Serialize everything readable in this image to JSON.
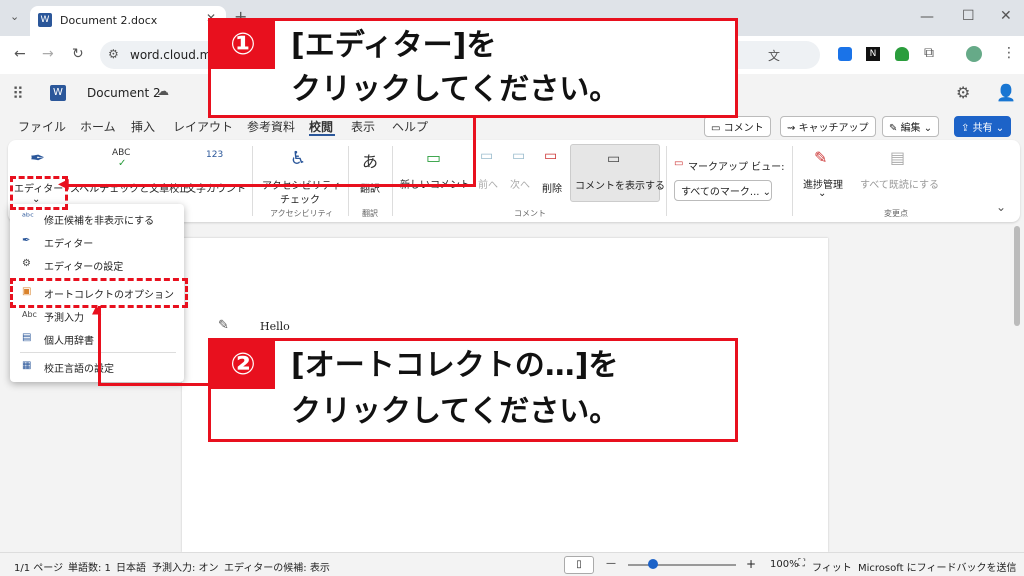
{
  "browser": {
    "tab_title": "Document 2.docx",
    "new_tab": "+",
    "url": "word.cloud.mic"
  },
  "app": {
    "doc_title": "Document 2",
    "logo": "W"
  },
  "menu": {
    "items": [
      "ファイル",
      "ホーム",
      "挿入",
      "レイアウト",
      "参考資料",
      "校閲",
      "表示",
      "ヘルプ"
    ],
    "comment_btn": "コメント",
    "catchup_btn": "キャッチアップ",
    "edit_btn": "編集",
    "share_btn": "共有"
  },
  "ribbon": {
    "editor": "エディター",
    "spellcheck": "スペルチェックと文章校正",
    "wordcount": "文字カウント",
    "accessibility_line1": "アクセシビリティ",
    "accessibility_line2": "チェック",
    "translate": "翻訳",
    "new_comment": "新しいコメント",
    "prev": "前へ",
    "next": "次へ",
    "delete": "削除",
    "show_comments": "コメントを表示する",
    "markup_view": "マークアップ ビュー:",
    "all_markup": "すべてのマーク...",
    "track_changes": "進捗管理",
    "accept_all": "すべて既読にする",
    "group_accessibility": "アクセシビリティ",
    "group_translate": "翻訳",
    "group_comments": "コメント",
    "group_changes": "変更点",
    "abc": "ABC",
    "num123": "123"
  },
  "dropdown": {
    "items": [
      "修正候補を非表示にする",
      "エディター",
      "エディターの設定",
      "オートコレクトのオプション",
      "予測入力",
      "個人用辞書",
      "校正言語の設定"
    ],
    "abc_small": "Abc"
  },
  "document": {
    "text": "Hello"
  },
  "status": {
    "page": "1/1 ページ",
    "words": "単語数: 1",
    "lang": "日本語",
    "predict": "予測入力: オン",
    "editor_suggest": "エディターの候補: 表示",
    "minus": "—",
    "plus": "+",
    "zoom": "100%",
    "fit": "フィット",
    "feedback": "Microsoft にフィードバックを送信"
  },
  "callouts": {
    "c1_num": "①",
    "c1_line1": "[エディター]を",
    "c1_line2": "クリックしてください。",
    "c2_num": "②",
    "c2_line1": "[オートコレクトの…]を",
    "c2_line2": "クリックしてください。"
  },
  "colors": {
    "accent_red": "#e8101e",
    "word_blue": "#2b579a",
    "share_blue": "#1d63c8"
  }
}
